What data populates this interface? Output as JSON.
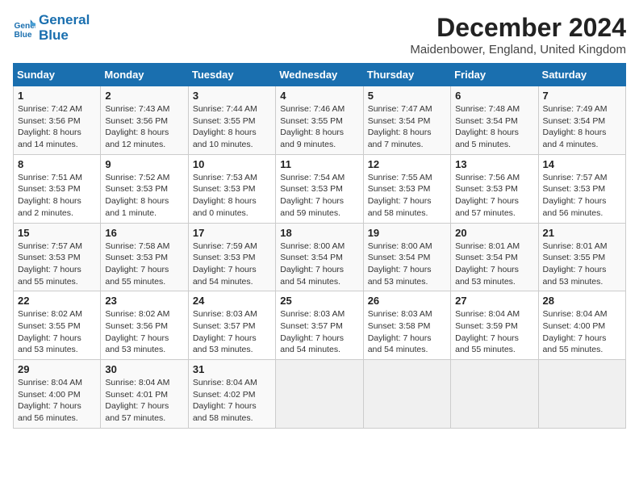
{
  "header": {
    "logo_line1": "General",
    "logo_line2": "Blue",
    "month": "December 2024",
    "location": "Maidenbower, England, United Kingdom"
  },
  "weekdays": [
    "Sunday",
    "Monday",
    "Tuesday",
    "Wednesday",
    "Thursday",
    "Friday",
    "Saturday"
  ],
  "weeks": [
    [
      {
        "day": "1",
        "sunrise": "7:42 AM",
        "sunset": "3:56 PM",
        "daylight": "8 hours and 14 minutes."
      },
      {
        "day": "2",
        "sunrise": "7:43 AM",
        "sunset": "3:56 PM",
        "daylight": "8 hours and 12 minutes."
      },
      {
        "day": "3",
        "sunrise": "7:44 AM",
        "sunset": "3:55 PM",
        "daylight": "8 hours and 10 minutes."
      },
      {
        "day": "4",
        "sunrise": "7:46 AM",
        "sunset": "3:55 PM",
        "daylight": "8 hours and 9 minutes."
      },
      {
        "day": "5",
        "sunrise": "7:47 AM",
        "sunset": "3:54 PM",
        "daylight": "8 hours and 7 minutes."
      },
      {
        "day": "6",
        "sunrise": "7:48 AM",
        "sunset": "3:54 PM",
        "daylight": "8 hours and 5 minutes."
      },
      {
        "day": "7",
        "sunrise": "7:49 AM",
        "sunset": "3:54 PM",
        "daylight": "8 hours and 4 minutes."
      }
    ],
    [
      {
        "day": "8",
        "sunrise": "7:51 AM",
        "sunset": "3:53 PM",
        "daylight": "8 hours and 2 minutes."
      },
      {
        "day": "9",
        "sunrise": "7:52 AM",
        "sunset": "3:53 PM",
        "daylight": "8 hours and 1 minute."
      },
      {
        "day": "10",
        "sunrise": "7:53 AM",
        "sunset": "3:53 PM",
        "daylight": "8 hours and 0 minutes."
      },
      {
        "day": "11",
        "sunrise": "7:54 AM",
        "sunset": "3:53 PM",
        "daylight": "7 hours and 59 minutes."
      },
      {
        "day": "12",
        "sunrise": "7:55 AM",
        "sunset": "3:53 PM",
        "daylight": "7 hours and 58 minutes."
      },
      {
        "day": "13",
        "sunrise": "7:56 AM",
        "sunset": "3:53 PM",
        "daylight": "7 hours and 57 minutes."
      },
      {
        "day": "14",
        "sunrise": "7:57 AM",
        "sunset": "3:53 PM",
        "daylight": "7 hours and 56 minutes."
      }
    ],
    [
      {
        "day": "15",
        "sunrise": "7:57 AM",
        "sunset": "3:53 PM",
        "daylight": "7 hours and 55 minutes."
      },
      {
        "day": "16",
        "sunrise": "7:58 AM",
        "sunset": "3:53 PM",
        "daylight": "7 hours and 55 minutes."
      },
      {
        "day": "17",
        "sunrise": "7:59 AM",
        "sunset": "3:53 PM",
        "daylight": "7 hours and 54 minutes."
      },
      {
        "day": "18",
        "sunrise": "8:00 AM",
        "sunset": "3:54 PM",
        "daylight": "7 hours and 54 minutes."
      },
      {
        "day": "19",
        "sunrise": "8:00 AM",
        "sunset": "3:54 PM",
        "daylight": "7 hours and 53 minutes."
      },
      {
        "day": "20",
        "sunrise": "8:01 AM",
        "sunset": "3:54 PM",
        "daylight": "7 hours and 53 minutes."
      },
      {
        "day": "21",
        "sunrise": "8:01 AM",
        "sunset": "3:55 PM",
        "daylight": "7 hours and 53 minutes."
      }
    ],
    [
      {
        "day": "22",
        "sunrise": "8:02 AM",
        "sunset": "3:55 PM",
        "daylight": "7 hours and 53 minutes."
      },
      {
        "day": "23",
        "sunrise": "8:02 AM",
        "sunset": "3:56 PM",
        "daylight": "7 hours and 53 minutes."
      },
      {
        "day": "24",
        "sunrise": "8:03 AM",
        "sunset": "3:57 PM",
        "daylight": "7 hours and 53 minutes."
      },
      {
        "day": "25",
        "sunrise": "8:03 AM",
        "sunset": "3:57 PM",
        "daylight": "7 hours and 54 minutes."
      },
      {
        "day": "26",
        "sunrise": "8:03 AM",
        "sunset": "3:58 PM",
        "daylight": "7 hours and 54 minutes."
      },
      {
        "day": "27",
        "sunrise": "8:04 AM",
        "sunset": "3:59 PM",
        "daylight": "7 hours and 55 minutes."
      },
      {
        "day": "28",
        "sunrise": "8:04 AM",
        "sunset": "4:00 PM",
        "daylight": "7 hours and 55 minutes."
      }
    ],
    [
      {
        "day": "29",
        "sunrise": "8:04 AM",
        "sunset": "4:00 PM",
        "daylight": "7 hours and 56 minutes."
      },
      {
        "day": "30",
        "sunrise": "8:04 AM",
        "sunset": "4:01 PM",
        "daylight": "7 hours and 57 minutes."
      },
      {
        "day": "31",
        "sunrise": "8:04 AM",
        "sunset": "4:02 PM",
        "daylight": "7 hours and 58 minutes."
      },
      null,
      null,
      null,
      null
    ]
  ]
}
